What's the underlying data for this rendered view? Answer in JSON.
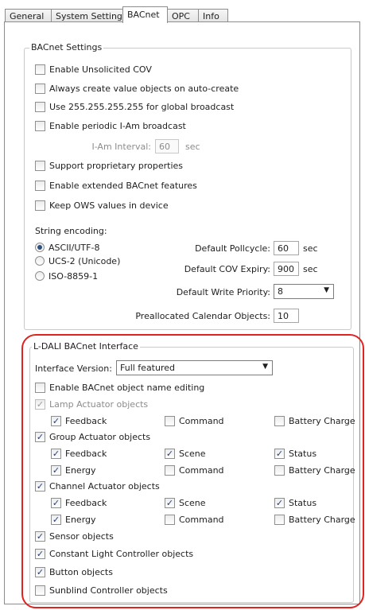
{
  "tabs": [
    {
      "label": "General"
    },
    {
      "label": "System Settings"
    },
    {
      "label": "BACnet"
    },
    {
      "label": "OPC"
    },
    {
      "label": "Info"
    }
  ],
  "bacnet_settings": {
    "title": "BACnet Settings",
    "enable_unsolicited_cov": {
      "label": "Enable Unsolicited COV",
      "checked": false
    },
    "always_create_value_objects": {
      "label": "Always create value objects on auto-create",
      "checked": false
    },
    "use_global_broadcast": {
      "label": "Use 255.255.255.255 for global broadcast",
      "checked": false
    },
    "enable_periodic_iam": {
      "label": "Enable periodic I-Am broadcast",
      "checked": false
    },
    "iam_interval": {
      "label": "I-Am Interval:",
      "value": "60",
      "unit": "sec"
    },
    "support_proprietary": {
      "label": "Support proprietary properties",
      "checked": false
    },
    "enable_extended": {
      "label": "Enable extended BACnet features",
      "checked": false
    },
    "keep_ows_values": {
      "label": "Keep OWS values in device",
      "checked": false
    },
    "string_encoding": {
      "label": "String encoding:",
      "options": [
        "ASCII/UTF-8",
        "UCS-2 (Unicode)",
        "ISO-8859-1"
      ],
      "selected": "ASCII/UTF-8"
    },
    "default_pollcycle": {
      "label": "Default Pollcycle:",
      "value": "60",
      "unit": "sec"
    },
    "default_cov_expiry": {
      "label": "Default COV Expiry:",
      "value": "900",
      "unit": "sec"
    },
    "default_write_priority": {
      "label": "Default Write Priority:",
      "value": "8"
    },
    "preallocated_calendar": {
      "label": "Preallocated Calendar Objects:",
      "value": "10"
    }
  },
  "ldali": {
    "title": "L-DALI BACnet Interface",
    "interface_version": {
      "label": "Interface Version:",
      "value": "Full featured"
    },
    "enable_name_editing": {
      "label": "Enable BACnet object name editing",
      "checked": false
    },
    "lamp": {
      "label": "Lamp Actuator objects",
      "feedback": "Feedback",
      "command": "Command",
      "battery": "Battery Charge"
    },
    "group": {
      "label": "Group Actuator objects",
      "feedback": "Feedback",
      "scene": "Scene",
      "status": "Status",
      "energy": "Energy",
      "command": "Command",
      "battery": "Battery Charge"
    },
    "channel": {
      "label": "Channel Actuator objects",
      "feedback": "Feedback",
      "scene": "Scene",
      "status": "Status",
      "energy": "Energy",
      "command": "Command",
      "battery": "Battery Charge"
    },
    "sensor": {
      "label": "Sensor objects"
    },
    "constant_light": {
      "label": "Constant Light Controller objects"
    },
    "button": {
      "label": "Button objects"
    },
    "sunblind": {
      "label": "Sunblind Controller objects"
    }
  },
  "colors": {
    "highlight": "#e3211f",
    "check": "#253d77"
  }
}
